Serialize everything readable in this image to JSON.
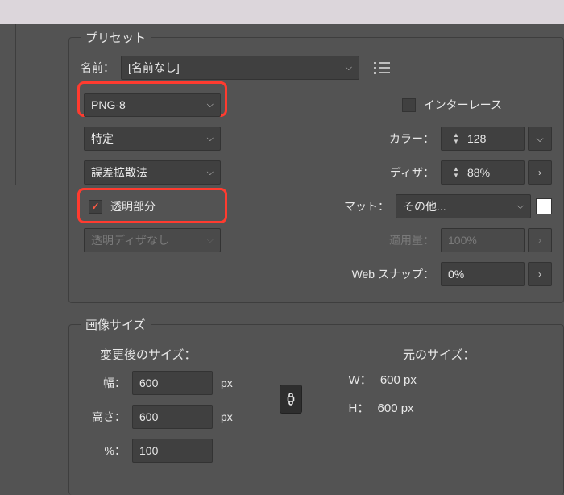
{
  "preset": {
    "legend": "プリセット",
    "name_label": "名前：",
    "name_value": "[名前なし]",
    "format": "PNG-8",
    "interlace_label": "インターレース",
    "interlace_checked": false,
    "reduction": "特定",
    "color_label": "カラー：",
    "color_value": "128",
    "dither_algo": "誤差拡散法",
    "dither_label": "ディザ：",
    "dither_value": "88%",
    "transparency_label": "透明部分",
    "transparency_checked": true,
    "matte_label": "マット：",
    "matte_value": "その他...",
    "trans_dither": "透明ディザなし",
    "amount_label": "適用量：",
    "amount_value": "100%",
    "web_snap_label": "Web スナップ：",
    "web_snap_value": "0%"
  },
  "image_size": {
    "legend": "画像サイズ",
    "new_heading": "変更後のサイズ：",
    "orig_heading": "元のサイズ：",
    "width_label": "幅：",
    "width_value": "600",
    "height_label": "高さ：",
    "height_value": "600",
    "percent_label": "%：",
    "percent_value": "100",
    "unit": "px",
    "orig_w_label": "W：",
    "orig_w_value": "600 px",
    "orig_h_label": "H：",
    "orig_h_value": "600 px"
  }
}
